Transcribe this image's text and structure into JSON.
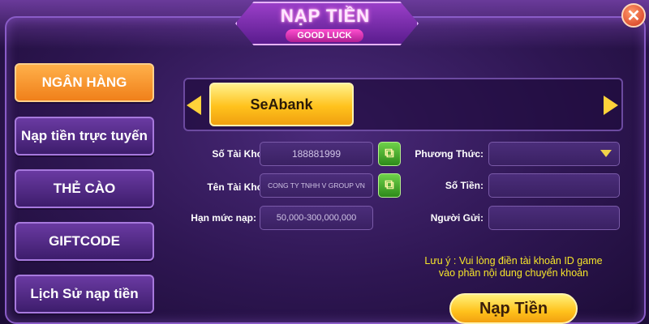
{
  "header": {
    "title": "NẠP TIỀN",
    "subtitle": "GOOD LUCK",
    "close_symbol": "✕"
  },
  "menu": [
    {
      "label": "NGÂN HÀNG",
      "active": true
    },
    {
      "label": "Nạp tiền trực tuyến",
      "active": false
    },
    {
      "label": "THẺ CÀO",
      "active": false
    },
    {
      "label": "GIFTCODE",
      "active": false
    },
    {
      "label": "Lịch Sử nạp tiền",
      "active": false
    }
  ],
  "bank_selector": {
    "selected": "SeAbank",
    "prev_icon": "triangle-left",
    "next_icon": "triangle-right"
  },
  "form": {
    "account_number": {
      "label": "Số Tài Khoản:",
      "value": "188881999"
    },
    "account_name": {
      "label": "Tên Tài Khoản:",
      "value": "CONG TY TNHH V GROUP VN"
    },
    "limit": {
      "label": "Hạn mức nạp:",
      "value": "50,000-300,000,000"
    },
    "method": {
      "label": "Phương Thức:",
      "value": ""
    },
    "amount": {
      "label": "Số Tiền:",
      "value": ""
    },
    "sender": {
      "label": "Người Gửi:",
      "value": ""
    }
  },
  "note": {
    "line1": "Lưu ý : Vui lòng điền tài khoản ID game",
    "line2": "vào phần nội dung chuyển khoản"
  },
  "submit_label": "Nạp Tiền",
  "colors": {
    "accent_orange": "#f0801a",
    "gold": "#ffc21c",
    "note_yellow": "#f6e62a",
    "copy_green": "#2d8a1a"
  }
}
